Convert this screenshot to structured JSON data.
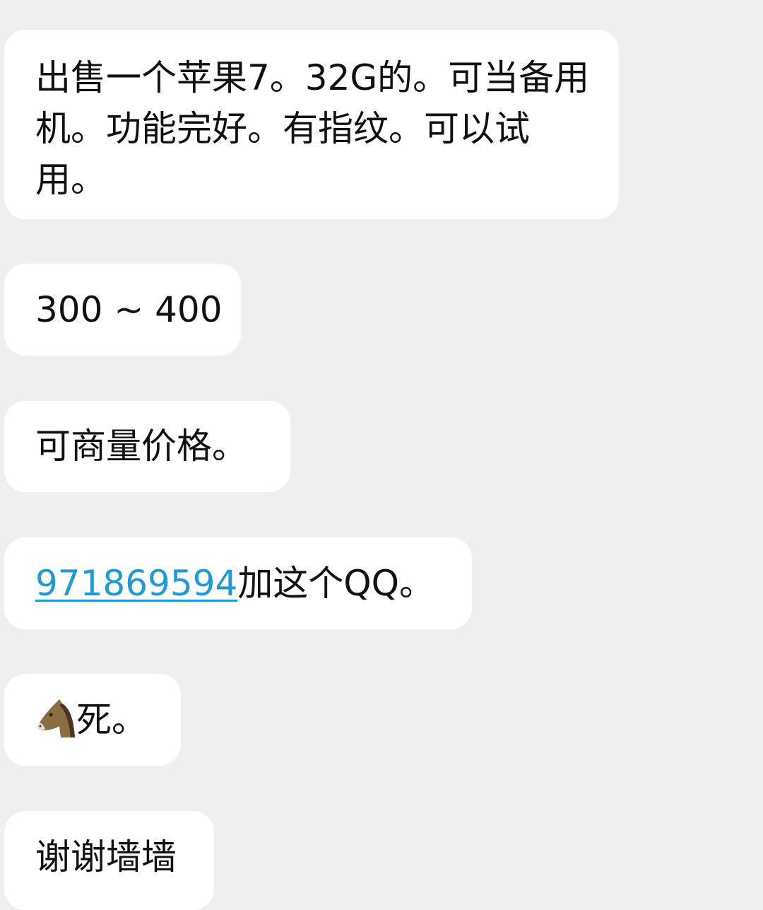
{
  "messages": [
    {
      "text": "出售一个苹果7。32G的。可当备用机。功能完好。有指纹。可以试用。"
    },
    {
      "text": "300 ~ 400"
    },
    {
      "text": "可商量价格。"
    },
    {
      "link": "971869594",
      "text": "加这个QQ。"
    },
    {
      "emoji": "horse-face-icon",
      "text": "死。"
    },
    {
      "text": "谢谢墙墙"
    }
  ],
  "colors": {
    "background": "#efefef",
    "bubble": "#ffffff",
    "link": "#1e9ad6"
  }
}
